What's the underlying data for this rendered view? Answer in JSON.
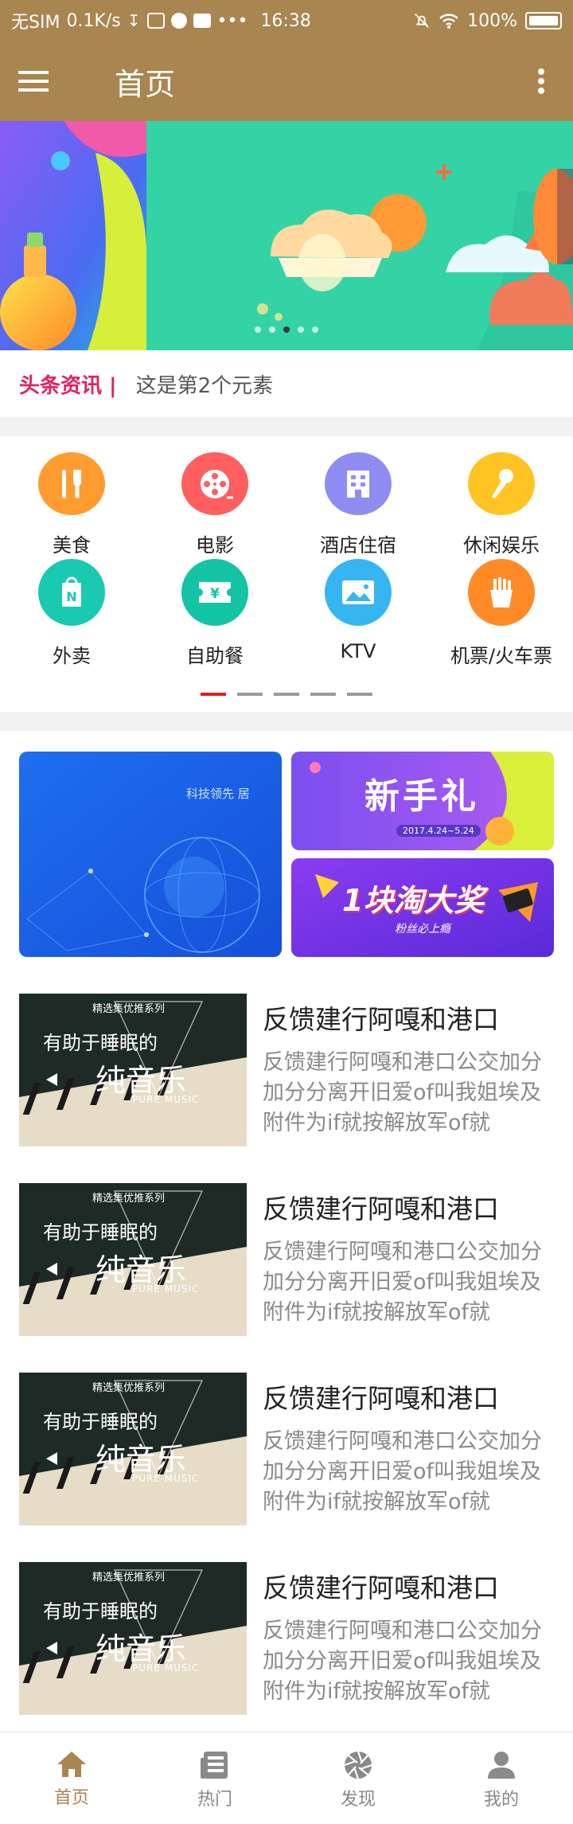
{
  "status_bar": {
    "carrier": "无SIM",
    "speed": "0.1K/s",
    "time": "16:38",
    "battery": "100%"
  },
  "app_bar": {
    "title": "首页",
    "menu_icon": "hamburger-menu-icon",
    "more_icon": "more-vertical-icon"
  },
  "banner": {
    "dot_count": 5,
    "active_dot": 2
  },
  "ticker": {
    "label": "头条资讯 |",
    "text": "这是第2个元素"
  },
  "categories": [
    {
      "label": "美食",
      "color": "#ff9b2f",
      "icon": "fork-knife-icon"
    },
    {
      "label": "电影",
      "color": "#ff5f5f",
      "icon": "film-reel-icon"
    },
    {
      "label": "酒店住宿",
      "color": "#8f8cf4",
      "icon": "hotel-icon"
    },
    {
      "label": "休闲娱乐",
      "color": "#ffc423",
      "icon": "microphone-icon"
    },
    {
      "label": "外卖",
      "color": "#19c9b0",
      "icon": "takeout-bag-icon"
    },
    {
      "label": "自助餐",
      "color": "#14c3a4",
      "icon": "ticket-yen-icon"
    },
    {
      "label": "KTV",
      "color": "#36b6f0",
      "icon": "picture-icon"
    },
    {
      "label": "机票/火车票",
      "color": "#ff8a26",
      "icon": "fries-icon"
    }
  ],
  "category_pager": {
    "count": 5,
    "active": 0
  },
  "promos": {
    "left_text": "科技领先  居",
    "right_top_text": "新手礼",
    "right_top_date": "2017.4.24~5.24",
    "right_bottom_text": "1块淘大奖",
    "right_bottom_sub": "粉丝必上瘾"
  },
  "articles": [
    {
      "title": "反馈建行阿嘎和港口",
      "desc": "反馈建行阿嘎和港口公交加分加分分离开旧爱of叫我姐埃及附件为if就按解放军of就",
      "thumb_tag": "精选集优推系列",
      "thumb_line1": "有助于睡眠的",
      "thumb_line2": "纯音乐",
      "thumb_line3": "PURE MUSIC"
    },
    {
      "title": "反馈建行阿嘎和港口",
      "desc": "反馈建行阿嘎和港口公交加分加分分离开旧爱of叫我姐埃及附件为if就按解放军of就",
      "thumb_tag": "精选集优推系列",
      "thumb_line1": "有助于睡眠的",
      "thumb_line2": "纯音乐",
      "thumb_line3": "PURE MUSIC"
    },
    {
      "title": "反馈建行阿嘎和港口",
      "desc": "反馈建行阿嘎和港口公交加分加分分离开旧爱of叫我姐埃及附件为if就按解放军of就",
      "thumb_tag": "精选集优推系列",
      "thumb_line1": "有助于睡眠的",
      "thumb_line2": "纯音乐",
      "thumb_line3": "PURE MUSIC"
    },
    {
      "title": "反馈建行阿嘎和港口",
      "desc": "反馈建行阿嘎和港口公交加分加分分离开旧爱of叫我姐埃及附件为if就按解放军of就",
      "thumb_tag": "精选集优推系列",
      "thumb_line1": "有助于睡眠的",
      "thumb_line2": "纯音乐",
      "thumb_line3": "PURE MUSIC"
    }
  ],
  "bottom_nav": [
    {
      "label": "首页",
      "icon": "home-icon",
      "active": true
    },
    {
      "label": "热门",
      "icon": "newspaper-icon",
      "active": false
    },
    {
      "label": "发现",
      "icon": "aperture-icon",
      "active": false
    },
    {
      "label": "我的",
      "icon": "user-icon",
      "active": false
    }
  ],
  "colors": {
    "primary": "#a9854f",
    "ticker_label": "#e0235f",
    "pager_active": "#e02020"
  }
}
